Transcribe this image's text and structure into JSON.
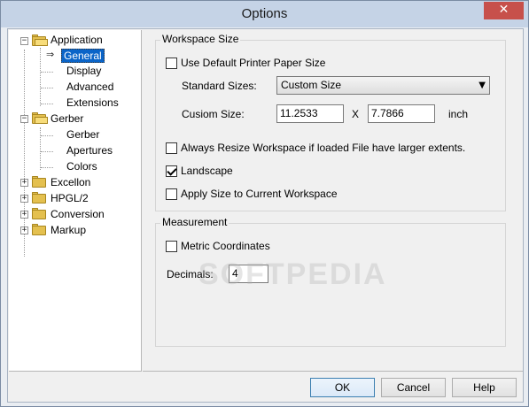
{
  "window": {
    "title": "Options",
    "close_glyph": "✕"
  },
  "tree": {
    "items": [
      {
        "label": "Application",
        "expander": "−"
      },
      {
        "label": "General",
        "selected": true
      },
      {
        "label": "Display"
      },
      {
        "label": "Advanced"
      },
      {
        "label": "Extensions"
      },
      {
        "label": "Gerber",
        "expander": "−"
      },
      {
        "label": "Gerber"
      },
      {
        "label": "Apertures"
      },
      {
        "label": "Colors"
      },
      {
        "label": "Excellon",
        "expander": "+"
      },
      {
        "label": "HPGL/2",
        "expander": "+"
      },
      {
        "label": "Conversion",
        "expander": "+"
      },
      {
        "label": "Markup",
        "expander": "+"
      }
    ],
    "selected_marker": "⇒"
  },
  "workspace": {
    "title": "Workspace Size",
    "use_default_printer": {
      "label": "Use Default Printer Paper Size",
      "checked": false
    },
    "standard_sizes": {
      "label": "Standard Sizes:",
      "value": "Custom Size",
      "chevron": "▼"
    },
    "custom_size": {
      "label": "Cusiom Size:",
      "width": "11.2533",
      "separator": "X",
      "height": "7.7866",
      "unit": "inch"
    },
    "always_resize": {
      "label": "Always Resize Workspace if loaded File have larger extents.",
      "checked": false
    },
    "landscape": {
      "label": "Landscape",
      "checked": true
    },
    "apply_size": {
      "label": "Apply Size to Current Workspace",
      "checked": false
    }
  },
  "measurement": {
    "title": "Measurement",
    "metric": {
      "label": "Metric Coordinates",
      "checked": false
    },
    "decimals": {
      "label": "Decimals:",
      "value": "4"
    }
  },
  "watermark": "SOFTPEDIA",
  "buttons": {
    "ok": "OK",
    "cancel": "Cancel",
    "help": "Help"
  }
}
